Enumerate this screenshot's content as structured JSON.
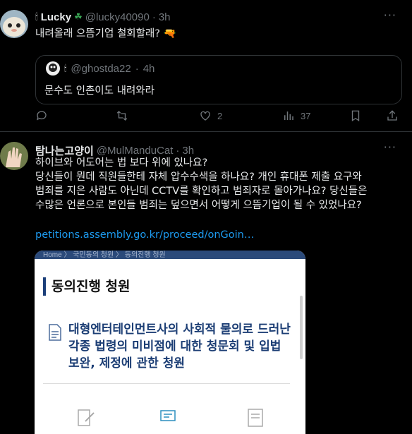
{
  "tweet1": {
    "name": "Lucky",
    "handle": "@lucky40090",
    "time": "3h",
    "sep": "·",
    "text": "내려올래 으뜸기업 철회할래? 🔫",
    "quote": {
      "handle": "@ghostda22",
      "time": "4h",
      "text": "문수도 인촌이도 내려와라"
    },
    "actions": {
      "reply": "",
      "retweet": "",
      "like": "2",
      "views": "37"
    }
  },
  "tweet2": {
    "name": "탐나는고양이",
    "handle": "@MulManduCat",
    "time": "3h",
    "sep": "·",
    "lines": [
      "하이브와 어도어는 법 보다 위에 있나요?",
      "당신들이 뭔데 직원들한테 자체 압수수색을 하나요? 개인 휴대폰 제출 요구와",
      "범죄를 지은 사람도 아닌데 CCTV를 확인하고 범죄자로 몰아가나요? 당신들은",
      "수많은 언론으로 본인들 범죄는 덮으면서 어떻게 으뜸기업이 될 수 있었나요?"
    ],
    "link": "petitions.assembly.go.kr/proceed/onGoin…",
    "card": {
      "breadcrumb": "Home 〉 국민동의 청원 〉 동의진행 청원",
      "heading": "동의진행 청원",
      "title": "대형엔터테인먼트사의 사회적 물의로 드러난 각종 법령의 미비점에 대한 청문회 및 입법 보완, 제정에 관한 청원"
    }
  },
  "icons": [
    "reply-icon",
    "retweet-icon",
    "like-icon",
    "views-icon",
    "share-icon",
    "more-icon",
    "document-icon"
  ],
  "colors": {
    "background": "#000000",
    "text": "#e7e9ea",
    "muted": "#71767b",
    "link": "#1d9bf0",
    "border": "#2f3336",
    "card_title": "#1b3d74"
  }
}
